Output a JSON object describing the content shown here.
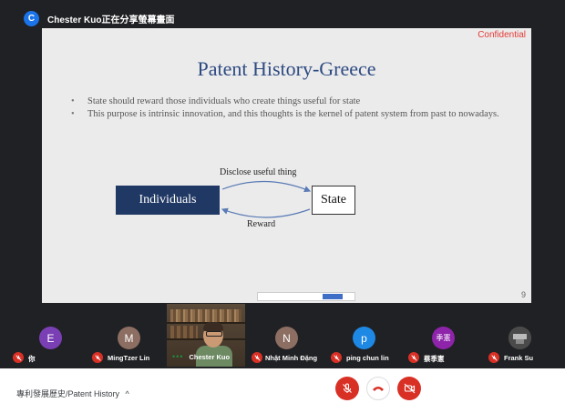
{
  "header": {
    "presenter_initial": "C",
    "sharing_text": "Chester Kuo正在分享螢幕畫面"
  },
  "slide": {
    "confidential": "Confidential",
    "title": "Patent History-Greece",
    "bullets": [
      "State should reward those individuals who create things useful for state",
      "This purpose is intrinsic innovation, and this thoughts is the kernel of patent system from past to nowadays."
    ],
    "diagram": {
      "top_label": "Disclose useful thing",
      "bottom_label": "Reward",
      "left_box": "Individuals",
      "right_box": "State"
    },
    "page_number": "9"
  },
  "participants": [
    {
      "initial": "E",
      "name": "你",
      "color": "#7b3fb5",
      "muted": true
    },
    {
      "initial": "M",
      "name": "MingTzer Lin",
      "color": "#8d6e63",
      "muted": true
    },
    {
      "initial": "",
      "name": "Chester Kuo",
      "color": "",
      "muted": false,
      "speaking": true
    },
    {
      "initial": "N",
      "name": "Nhật Minh Đặng",
      "color": "#8d6e63",
      "muted": true
    },
    {
      "initial": "p",
      "name": "ping chun lin",
      "color": "#1e88e5",
      "muted": true
    },
    {
      "initial": "季憲",
      "name": "蔡季憲",
      "color": "#8e24aa",
      "muted": true
    },
    {
      "initial": "",
      "name": "Frank Su",
      "color": "#555555",
      "muted": true
    }
  ],
  "footer": {
    "meeting_title": "專利發展歷史/Patent History",
    "expand_icon": "chevron-up-icon",
    "controls": [
      "mic-off-icon",
      "end-call-icon",
      "camera-off-icon"
    ]
  },
  "colors": {
    "accent_red": "#d93025",
    "slide_title": "#2e4a82",
    "box_fill": "#203864"
  }
}
